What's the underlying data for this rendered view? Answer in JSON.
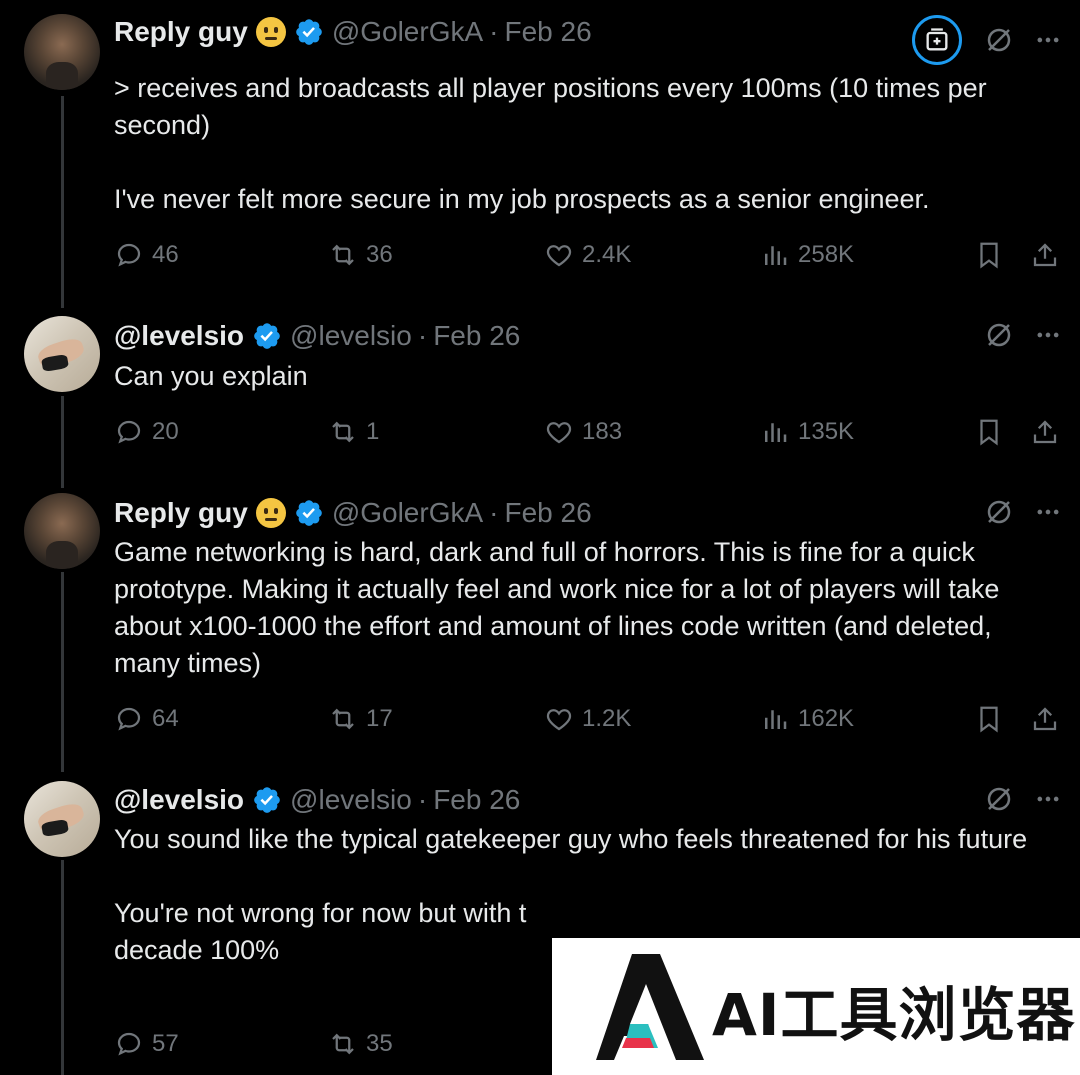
{
  "tweets": [
    {
      "display_name": "Reply guy",
      "handle": "@GolerGkA",
      "separator": "·",
      "date": "Feb 26",
      "text": "> receives and broadcasts all player positions every 100ms (10 times per second)\n\nI've never felt more secure in my job prospects as a senior engineer.",
      "replies": "46",
      "reposts": "36",
      "likes": "2.4K",
      "views": "258K"
    },
    {
      "display_name": "@levelsio",
      "handle": "@levelsio",
      "separator": "·",
      "date": "Feb 26",
      "text": "Can you explain",
      "replies": "20",
      "reposts": "1",
      "likes": "183",
      "views": "135K"
    },
    {
      "display_name": "Reply guy",
      "handle": "@GolerGkA",
      "separator": "·",
      "date": "Feb 26",
      "text": "Game networking is hard, dark and full of horrors. This is fine for a quick prototype. Making it actually feel and work nice for a lot of players will take about x100-1000 the effort and amount of lines code written (and deleted, many times)",
      "replies": "64",
      "reposts": "17",
      "likes": "1.2K",
      "views": "162K"
    },
    {
      "display_name": "@levelsio",
      "handle": "@levelsio",
      "separator": "·",
      "date": "Feb 26",
      "text": "You sound like the typical gatekeeper guy who feels threatened for his future\n\nYou're not wrong for now but with t\ndecade 100%",
      "replies": "57",
      "reposts": "35"
    }
  ],
  "watermark": {
    "text": "AI工具浏览器"
  },
  "colors": {
    "background": "#000000",
    "text": "#e7e9ea",
    "muted": "#71767b",
    "accent": "#1d9bf0"
  }
}
